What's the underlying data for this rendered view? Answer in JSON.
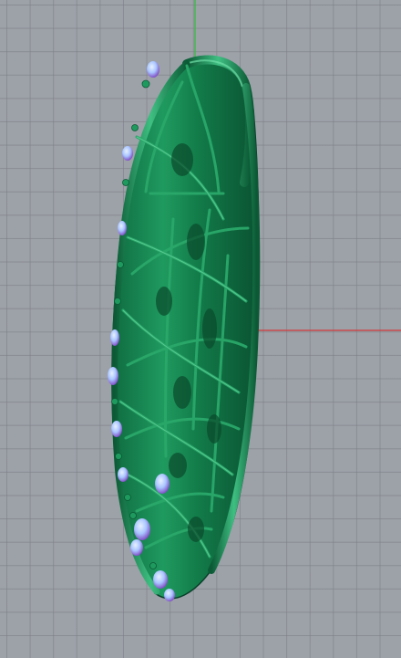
{
  "viewport": {
    "background_color": "#9da1a8",
    "grid_color": "#7f838a",
    "x_axis_color": "#d23a3a",
    "y_axis_color": "#2fbf3f"
  },
  "model": {
    "body_color": "#1f8a56",
    "highlight_color": "#5fd19a",
    "shadow_color": "#0d5a34",
    "gem_color": "#a9c6ff",
    "gem_edge_color": "#7b3fbf"
  }
}
